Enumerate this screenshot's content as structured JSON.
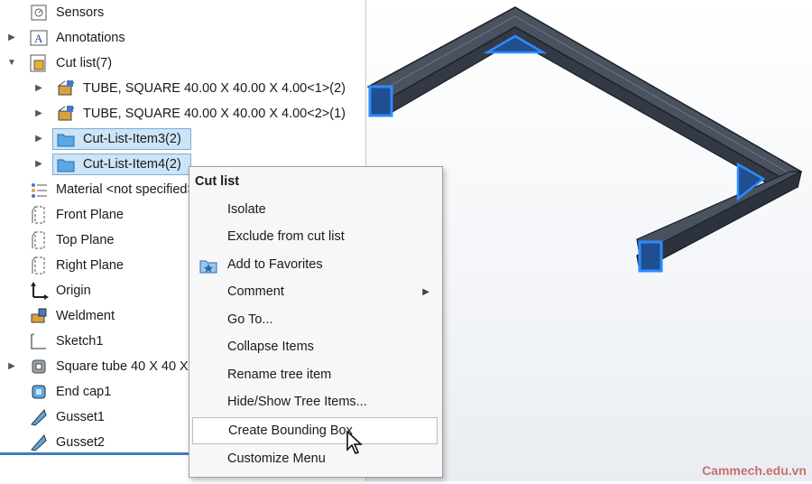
{
  "tree": {
    "items": [
      {
        "label": "Sensors",
        "arrow": "",
        "icon": "sensors-icon"
      },
      {
        "label": "Annotations",
        "arrow": "▶",
        "icon": "annotations-icon"
      },
      {
        "label": "Cut list(7)",
        "arrow": "▼",
        "icon": "cut-list-icon"
      },
      {
        "label": "TUBE, SQUARE 40.00 X 40.00 X 4.00<1>(2)",
        "arrow": "▶",
        "icon": "weldment-member-icon"
      },
      {
        "label": "TUBE, SQUARE 40.00 X 40.00 X 4.00<2>(1)",
        "arrow": "▶",
        "icon": "weldment-member-icon"
      },
      {
        "label": "Cut-List-Item3(2)",
        "arrow": "▶",
        "icon": "folder-icon",
        "selected": true
      },
      {
        "label": "Cut-List-Item4(2)",
        "arrow": "▶",
        "icon": "folder-icon",
        "selected": true
      },
      {
        "label": "Material <not specified>",
        "arrow": "",
        "icon": "material-icon"
      },
      {
        "label": "Front Plane",
        "arrow": "",
        "icon": "plane-icon"
      },
      {
        "label": "Top Plane",
        "arrow": "",
        "icon": "plane-icon"
      },
      {
        "label": "Right Plane",
        "arrow": "",
        "icon": "plane-icon"
      },
      {
        "label": "Origin",
        "arrow": "",
        "icon": "origin-icon"
      },
      {
        "label": "Weldment",
        "arrow": "",
        "icon": "weldment-icon"
      },
      {
        "label": "Sketch1",
        "arrow": "",
        "icon": "sketch-icon"
      },
      {
        "label": "Square tube 40 X 40 X 4",
        "arrow": "▶",
        "icon": "structural-member-icon"
      },
      {
        "label": "End cap1",
        "arrow": "",
        "icon": "end-cap-icon"
      },
      {
        "label": "Gusset1",
        "arrow": "",
        "icon": "gusset-icon"
      },
      {
        "label": "Gusset2",
        "arrow": "",
        "icon": "gusset-icon"
      }
    ]
  },
  "context_menu": {
    "title": "Cut list",
    "items": [
      {
        "label": "Isolate"
      },
      {
        "label": "Exclude from cut list"
      },
      {
        "label": "Add to Favorites",
        "icon": "favorites-star-icon"
      },
      {
        "label": "Comment",
        "submenu": true
      },
      {
        "label": "Go To..."
      },
      {
        "label": "Collapse Items"
      },
      {
        "label": "Rename tree item"
      },
      {
        "label": "Hide/Show Tree Items..."
      },
      {
        "label": "Create Bounding Box",
        "highlighted": true
      },
      {
        "label": "Customize Menu"
      }
    ]
  },
  "watermark": "Cammech.edu.vn",
  "colors": {
    "selection_bg": "#cce4f7",
    "selection_border": "#7aaed6",
    "tube_fill": "#3e4654",
    "face_highlight": "#1e6fd9",
    "watermark": "#c0504d"
  }
}
